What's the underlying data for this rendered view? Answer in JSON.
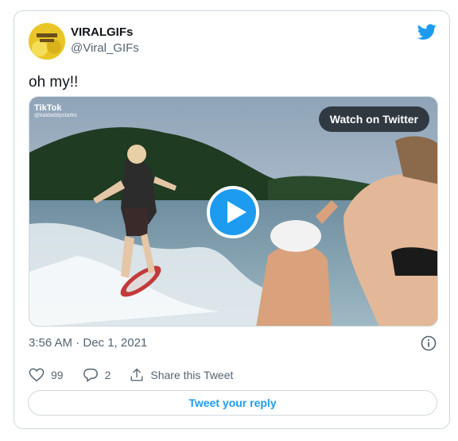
{
  "tweet": {
    "author_name": "VIRALGIFs",
    "author_handle": "@Viral_GIFs",
    "text": "oh my!!",
    "timestamp": "3:56 AM · Dec 1, 2021",
    "likes": "99",
    "replies": "2",
    "share_label": "Share this Tweet",
    "reply_button": "Tweet your reply"
  },
  "media": {
    "watch_label": "Watch on Twitter",
    "tiktok_label": "TikTok",
    "tiktok_handle": "@kaldaddystarks"
  },
  "icons": {
    "brand": "twitter-bird-icon",
    "play": "play-icon",
    "info": "info-icon",
    "like": "heart-icon",
    "reply": "reply-icon",
    "share": "share-icon"
  },
  "colors": {
    "accent": "#1d9bf0",
    "secondary_text": "#536471",
    "border": "#cfd9de"
  }
}
